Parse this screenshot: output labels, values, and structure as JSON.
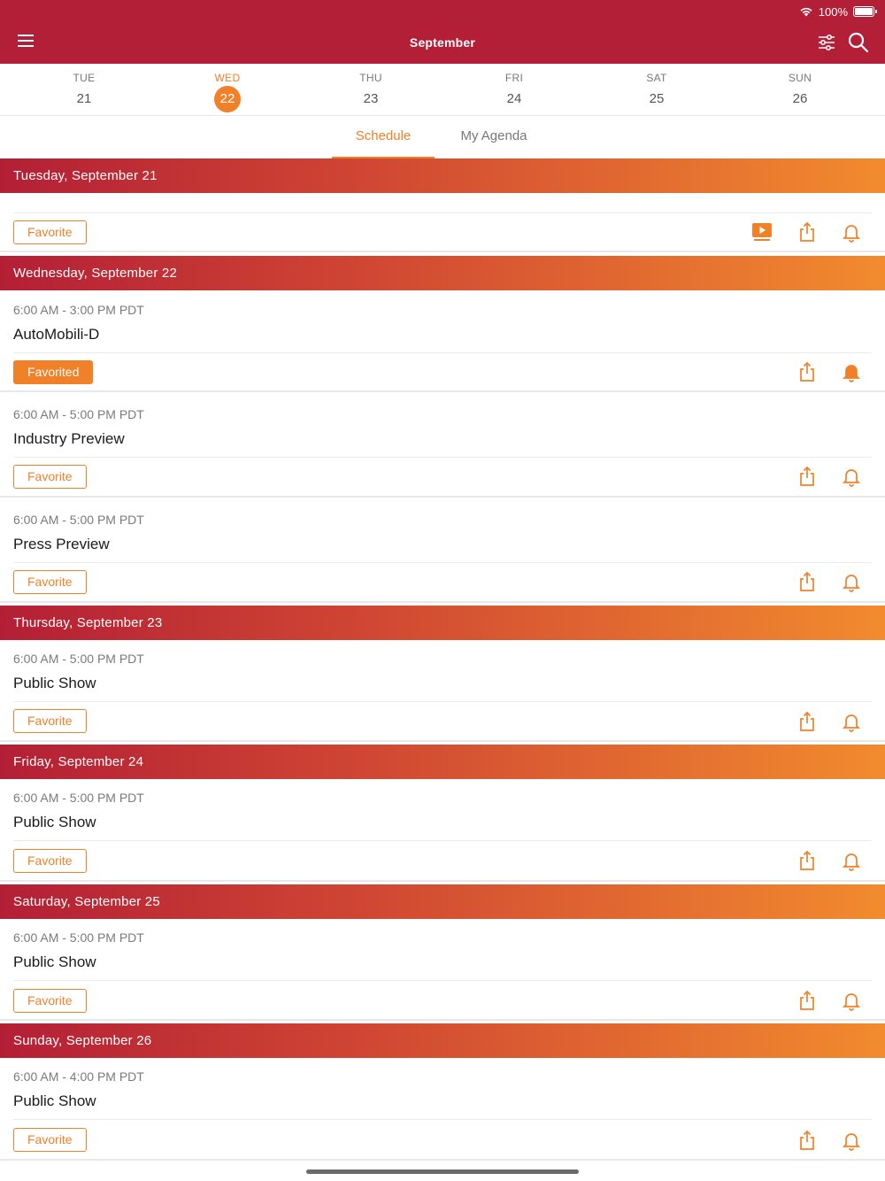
{
  "status": {
    "battery": "100%"
  },
  "header": {
    "title": "September"
  },
  "days": [
    {
      "dow": "TUE",
      "num": "21",
      "selected": false
    },
    {
      "dow": "WED",
      "num": "22",
      "selected": true
    },
    {
      "dow": "THU",
      "num": "23",
      "selected": false
    },
    {
      "dow": "FRI",
      "num": "24",
      "selected": false
    },
    {
      "dow": "SAT",
      "num": "25",
      "selected": false
    },
    {
      "dow": "SUN",
      "num": "26",
      "selected": false
    }
  ],
  "tabs": [
    {
      "label": "Schedule",
      "active": true
    },
    {
      "label": "My Agenda",
      "active": false
    }
  ],
  "sections": [
    {
      "heading": "Tuesday, September 21",
      "events": [
        {
          "time": "",
          "title": "",
          "favorite": "Favorite",
          "favorited": false,
          "video": true,
          "bell_filled": false
        }
      ]
    },
    {
      "heading": "Wednesday, September 22",
      "events": [
        {
          "time": "6:00 AM - 3:00 PM PDT",
          "title": "AutoMobili-D",
          "favorite": "Favorited",
          "favorited": true,
          "video": false,
          "bell_filled": true
        },
        {
          "time": "6:00 AM - 5:00 PM PDT",
          "title": "Industry Preview",
          "favorite": "Favorite",
          "favorited": false,
          "video": false,
          "bell_filled": false
        },
        {
          "time": "6:00 AM - 5:00 PM PDT",
          "title": "Press Preview",
          "favorite": "Favorite",
          "favorited": false,
          "video": false,
          "bell_filled": false
        }
      ]
    },
    {
      "heading": "Thursday, September 23",
      "events": [
        {
          "time": "6:00 AM - 5:00 PM PDT",
          "title": "Public Show",
          "favorite": "Favorite",
          "favorited": false,
          "video": false,
          "bell_filled": false
        }
      ]
    },
    {
      "heading": "Friday, September 24",
      "events": [
        {
          "time": "6:00 AM - 5:00 PM PDT",
          "title": "Public Show",
          "favorite": "Favorite",
          "favorited": false,
          "video": false,
          "bell_filled": false
        }
      ]
    },
    {
      "heading": "Saturday, September 25",
      "events": [
        {
          "time": "6:00 AM - 5:00 PM PDT",
          "title": "Public Show",
          "favorite": "Favorite",
          "favorited": false,
          "video": false,
          "bell_filled": false
        }
      ]
    },
    {
      "heading": "Sunday, September 26",
      "events": [
        {
          "time": "6:00 AM - 4:00 PM PDT",
          "title": "Public Show",
          "favorite": "Favorite",
          "favorited": false,
          "video": false,
          "bell_filled": false
        }
      ]
    }
  ],
  "icons": {
    "menu": "hamburger-menu-icon",
    "filter": "sliders-filter-icon",
    "search": "magnifier-search-icon",
    "wifi": "wifi-icon",
    "battery": "battery-icon",
    "video": "play-video-icon",
    "share": "share-icon",
    "bell": "bell-icon"
  },
  "colors": {
    "brand_red": "#b31f36",
    "accent_orange": "#f08129"
  }
}
